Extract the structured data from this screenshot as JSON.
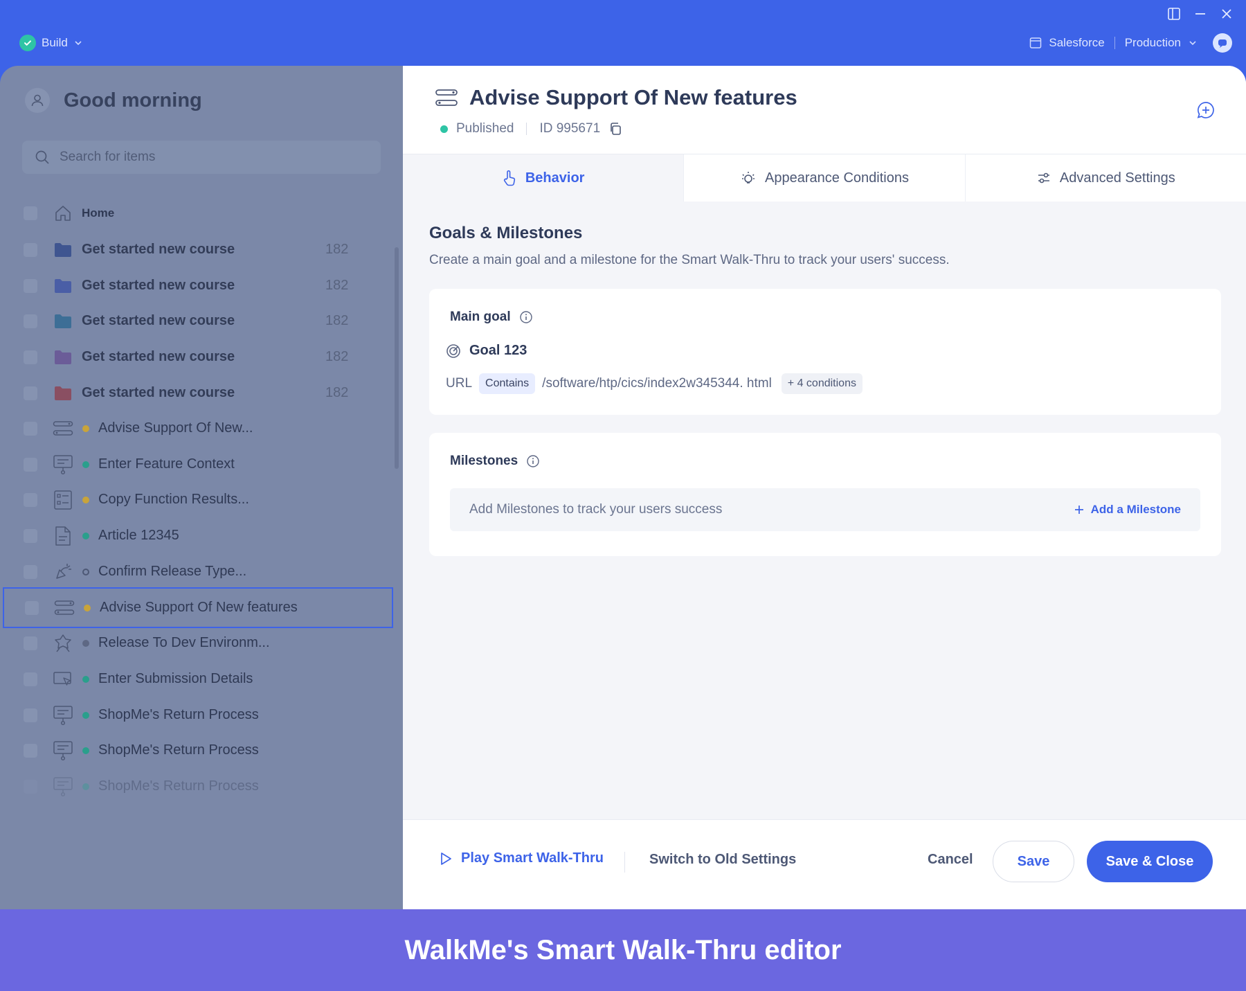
{
  "topbar": {
    "build_label": "Build",
    "system_label": "Salesforce",
    "env_label": "Production"
  },
  "sidebar": {
    "greeting": "Good morning",
    "search_placeholder": "Search for items",
    "home_label": "Home",
    "folders": [
      {
        "label": "Get started new course",
        "count": "182",
        "color": "#3f5590"
      },
      {
        "label": "Get started new course",
        "count": "182",
        "color": "#4a5ea6"
      },
      {
        "label": "Get started new course",
        "count": "182",
        "color": "#3d6e96"
      },
      {
        "label": "Get started new course",
        "count": "182",
        "color": "#6b5c98"
      },
      {
        "label": "Get started new course",
        "count": "182",
        "color": "#8a4f62"
      }
    ],
    "items": [
      {
        "label": "Advise Support Of New...",
        "icon": "walkthru-icon",
        "status": "#c9a43a"
      },
      {
        "label": "Enter Feature Context",
        "icon": "shoutout-icon",
        "status": "#2a9f8c"
      },
      {
        "label": "Copy Function Results...",
        "icon": "checklist-icon",
        "status": "#c9a43a"
      },
      {
        "label": "Article 12345",
        "icon": "article-icon",
        "status": "#2a9f8c"
      },
      {
        "label": "Confirm Release Type...",
        "icon": "smarttip-icon",
        "status": "hollow"
      },
      {
        "label": "Advise Support Of New features",
        "icon": "walkthru-icon",
        "status": "#c9a43a",
        "selected": true
      },
      {
        "label": "Release To Dev Environm...",
        "icon": "launcher-icon",
        "status": "#5e6884"
      },
      {
        "label": "Enter Submission Details",
        "icon": "display-icon",
        "status": "#2a9f8c"
      },
      {
        "label": "ShopMe's Return Process",
        "icon": "shoutout-icon",
        "status": "#2a9f8c"
      },
      {
        "label": "ShopMe's Return Process",
        "icon": "shoutout-icon",
        "status": "#2a9f8c"
      },
      {
        "label": "ShopMe's Return Process",
        "icon": "shoutout-icon",
        "status": "#2a9f8c",
        "faded": true
      }
    ]
  },
  "header": {
    "title": "Advise Support Of New features",
    "status": "Published",
    "id_text": "ID 995671"
  },
  "tabs": [
    {
      "label": "Behavior",
      "active": true
    },
    {
      "label": "Appearance Conditions"
    },
    {
      "label": "Advanced Settings"
    }
  ],
  "goals": {
    "section_title": "Goals & Milestones",
    "section_desc": "Create a main goal and a milestone for the Smart Walk-Thru to track your users' success.",
    "main_goal_label": "Main goal",
    "goal_name": "Goal 123",
    "url_label": "URL",
    "operator": "Contains",
    "url_value": "/software/htp/cics/index2w345344. html",
    "extra_conditions": "+ 4 conditions"
  },
  "milestones": {
    "label": "Milestones",
    "empty_text": "Add Milestones to track your users success",
    "add_label": "Add a Milestone"
  },
  "footer": {
    "play_label": "Play Smart Walk-Thru",
    "switch_label": "Switch to Old Settings",
    "cancel_label": "Cancel",
    "save_label": "Save",
    "save_close_label": "Save & Close"
  },
  "banner": {
    "caption": "WalkMe's Smart Walk-Thru editor"
  },
  "colors": {
    "accent": "#3d63e8",
    "published": "#2ec4a5",
    "banner": "#6b67e0"
  }
}
